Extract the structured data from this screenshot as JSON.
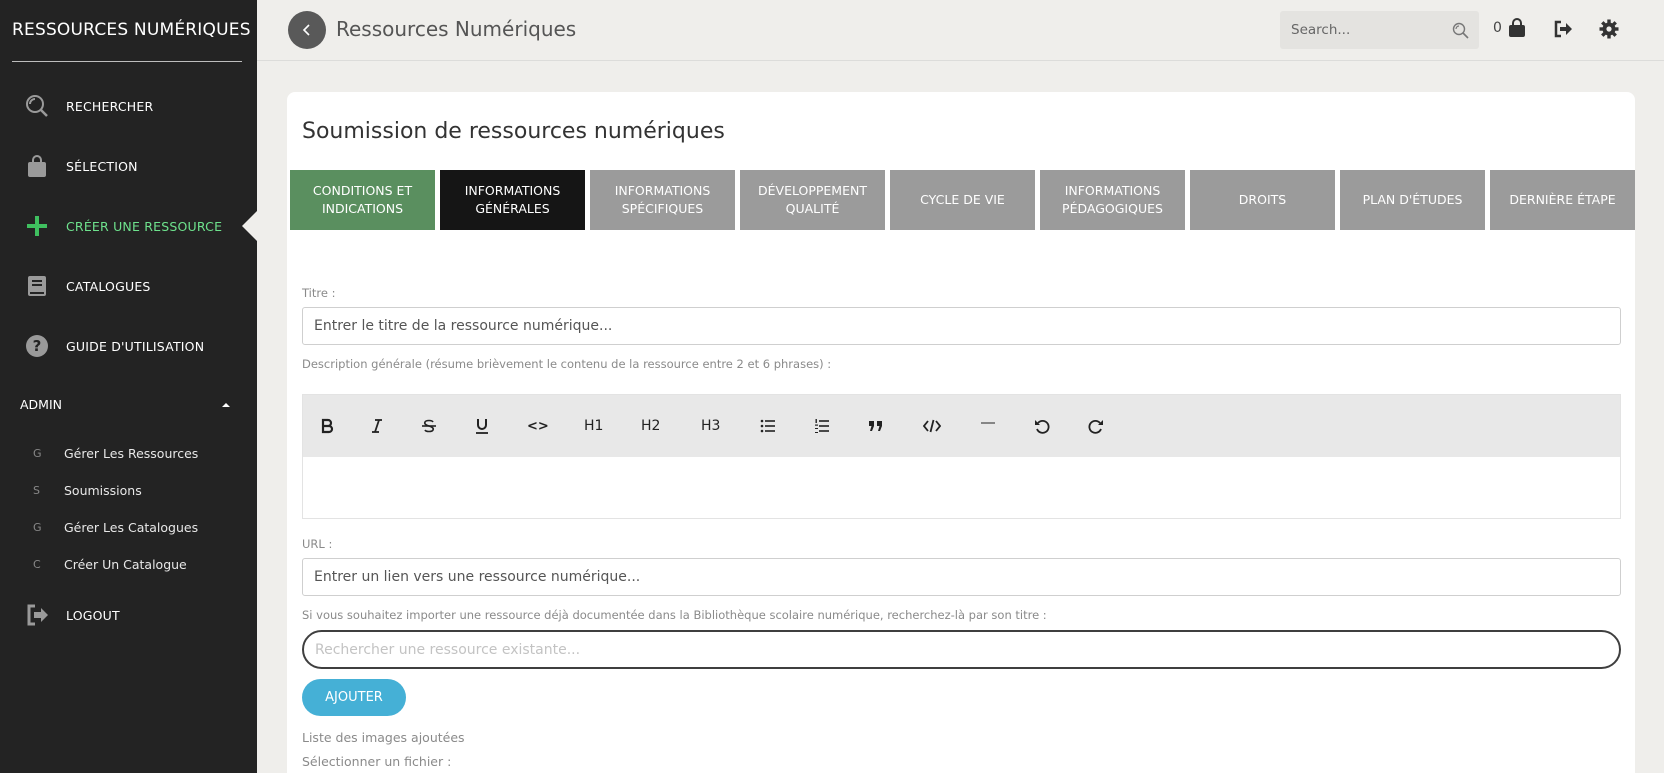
{
  "sidebar": {
    "brand": "RESSOURCES NUMÉRIQUES",
    "items": [
      {
        "label": "RECHERCHER",
        "icon": "search-icon"
      },
      {
        "label": "SÉLECTION",
        "icon": "shopping-bag-icon"
      },
      {
        "label": "CRÉER UNE RESSOURCE",
        "icon": "plus-icon"
      },
      {
        "label": "CATALOGUES",
        "icon": "book-icon"
      },
      {
        "label": "GUIDE D'UTILISATION",
        "icon": "question-icon"
      }
    ],
    "admin": {
      "label": "ADMIN",
      "items": [
        {
          "abbr": "G",
          "label": "Gérer Les Ressources"
        },
        {
          "abbr": "S",
          "label": "Soumissions"
        },
        {
          "abbr": "G",
          "label": "Gérer Les Catalogues"
        },
        {
          "abbr": "C",
          "label": "Créer Un Catalogue"
        }
      ]
    },
    "logout": "LOGOUT",
    "active_color": "#6ee28d"
  },
  "header": {
    "title": "Ressources Numériques",
    "search_placeholder": "Search...",
    "cart_count": "0"
  },
  "main": {
    "title": "Soumission de ressources numériques",
    "tabs": [
      {
        "label": "CONDITIONS ET INDICATIONS",
        "state": "done"
      },
      {
        "label": "INFORMATIONS GÉNÉRALES",
        "state": "current"
      },
      {
        "label": "INFORMATIONS SPÉCIFIQUES",
        "state": "pending"
      },
      {
        "label": "DÉVELOPPEMENT QUALITÉ",
        "state": "pending"
      },
      {
        "label": "CYCLE DE VIE",
        "state": "pending"
      },
      {
        "label": "INFORMATIONS PÉDAGOGIQUES",
        "state": "pending"
      },
      {
        "label": "DROITS",
        "state": "pending"
      },
      {
        "label": "PLAN D'ÉTUDES",
        "state": "pending"
      },
      {
        "label": "DERNIÈRE ÉTAPE",
        "state": "pending"
      }
    ],
    "title_label": "Titre :",
    "title_placeholder": "Entrer le titre de la ressource numérique...",
    "description_label": "Description générale (résume brièvement le contenu de la ressource entre 2 et 6 phrases) :",
    "editor_toolbar": {
      "h1": "H1",
      "h2": "H2",
      "h3": "H3",
      "inline_code": "<>"
    },
    "url_label": "URL :",
    "url_placeholder": "Entrer un lien vers une ressource numérique...",
    "import_label": "Si vous souhaitez importer une ressource déjà documentée dans la Bibliothèque scolaire numérique, recherchez-là par son titre :",
    "import_placeholder": "Rechercher une ressource existante...",
    "add_button": "AJOUTER",
    "images_list_label": "Liste des images ajoutées",
    "file_label": "Sélectionner un fichier :"
  },
  "colors": {
    "tab_done": "#5a8f5f",
    "tab_current": "#151515",
    "tab_pending": "#9b9b9b",
    "add_button": "#45b0d6"
  }
}
